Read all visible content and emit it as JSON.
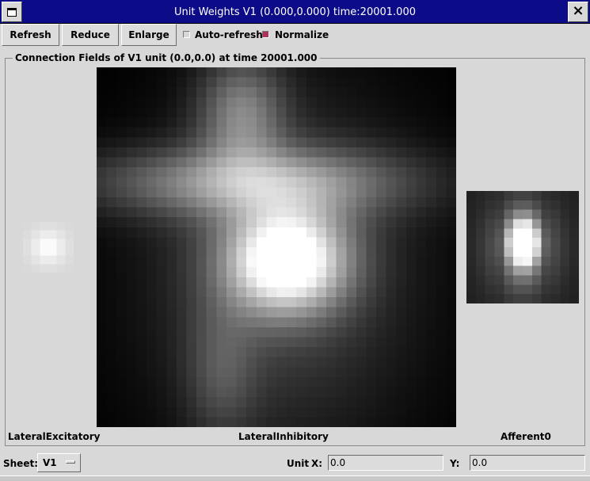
{
  "window": {
    "title": "Unit Weights  V1 (0.000,0.000) time:20001.000",
    "close_glyph": "×",
    "menu_icon": "window-menu-icon",
    "close_icon": "close-icon"
  },
  "toolbar": {
    "refresh_label": "Refresh",
    "reduce_label": "Reduce",
    "enlarge_label": "Enlarge",
    "autorefresh_label": "Auto-refresh",
    "autorefresh_checked": false,
    "normalize_label": "Normalize",
    "normalize_checked": true,
    "check_on_color": "#b03060"
  },
  "panel": {
    "title": "Connection Fields of V1 unit (0.0,0.0) at time 20001.000",
    "plots": {
      "lateral_excitatory": {
        "label": "LateralExcitatory"
      },
      "lateral_inhibitory": {
        "label": "LateralInhibitory"
      },
      "afferent": {
        "label": "Afferent0"
      }
    }
  },
  "bottom": {
    "sheet_label": "Sheet:",
    "sheet_value": "V1",
    "unit_label": "Unit",
    "x_label": "X:",
    "x_value": "0.0",
    "y_label": "Y:",
    "y_value": "0.0"
  }
}
